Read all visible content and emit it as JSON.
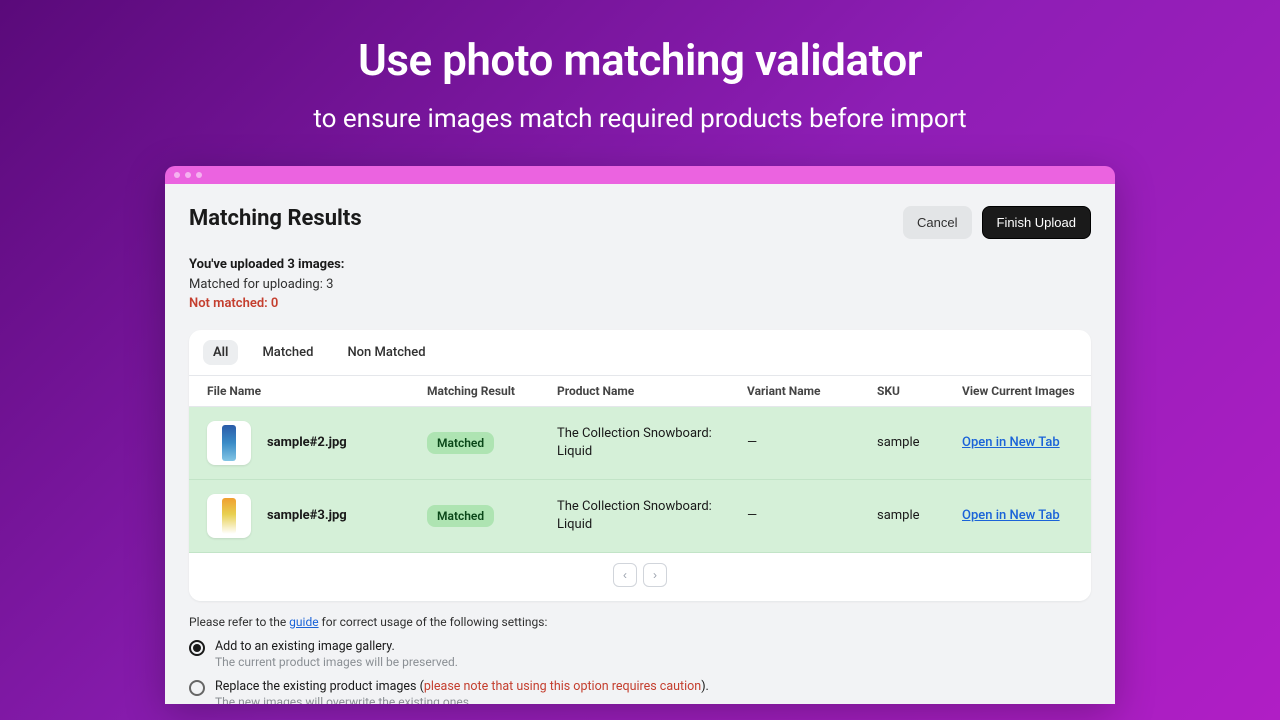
{
  "hero": {
    "title": "Use photo matching validator",
    "subtitle": "to ensure images match required products before import"
  },
  "header": {
    "title": "Matching Results",
    "cancel": "Cancel",
    "finish": "Finish Upload"
  },
  "summary": {
    "uploaded": "You've uploaded 3 images:",
    "matched": "Matched for uploading: 3",
    "not_matched": "Not matched: 0"
  },
  "tabs": {
    "all": "All",
    "matched": "Matched",
    "non_matched": "Non Matched"
  },
  "columns": {
    "file": "File Name",
    "result": "Matching Result",
    "product": "Product Name",
    "variant": "Variant Name",
    "sku": "SKU",
    "view": "View Current Images"
  },
  "rows": [
    {
      "file": "sample#2.jpg",
      "badge": "Matched",
      "product": "The Collection Snowboard: Liquid",
      "variant": "—",
      "sku": "sample",
      "link": "Open in New Tab"
    },
    {
      "file": "sample#3.jpg",
      "badge": "Matched",
      "product": "The Collection Snowboard: Liquid",
      "variant": "—",
      "sku": "sample",
      "link": "Open in New Tab"
    }
  ],
  "footer": {
    "pre": "Please refer to the ",
    "guide": "guide",
    "post": " for correct usage of the following settings:"
  },
  "options": {
    "opt1_t1": "Add to an existing image gallery.",
    "opt1_t2": "The current product images will be preserved.",
    "opt2_pre": "Replace the existing product images (",
    "opt2_warn": "please note that using this option requires caution",
    "opt2_post": ").",
    "opt2_t2": "The new images will overwrite the existing ones."
  }
}
